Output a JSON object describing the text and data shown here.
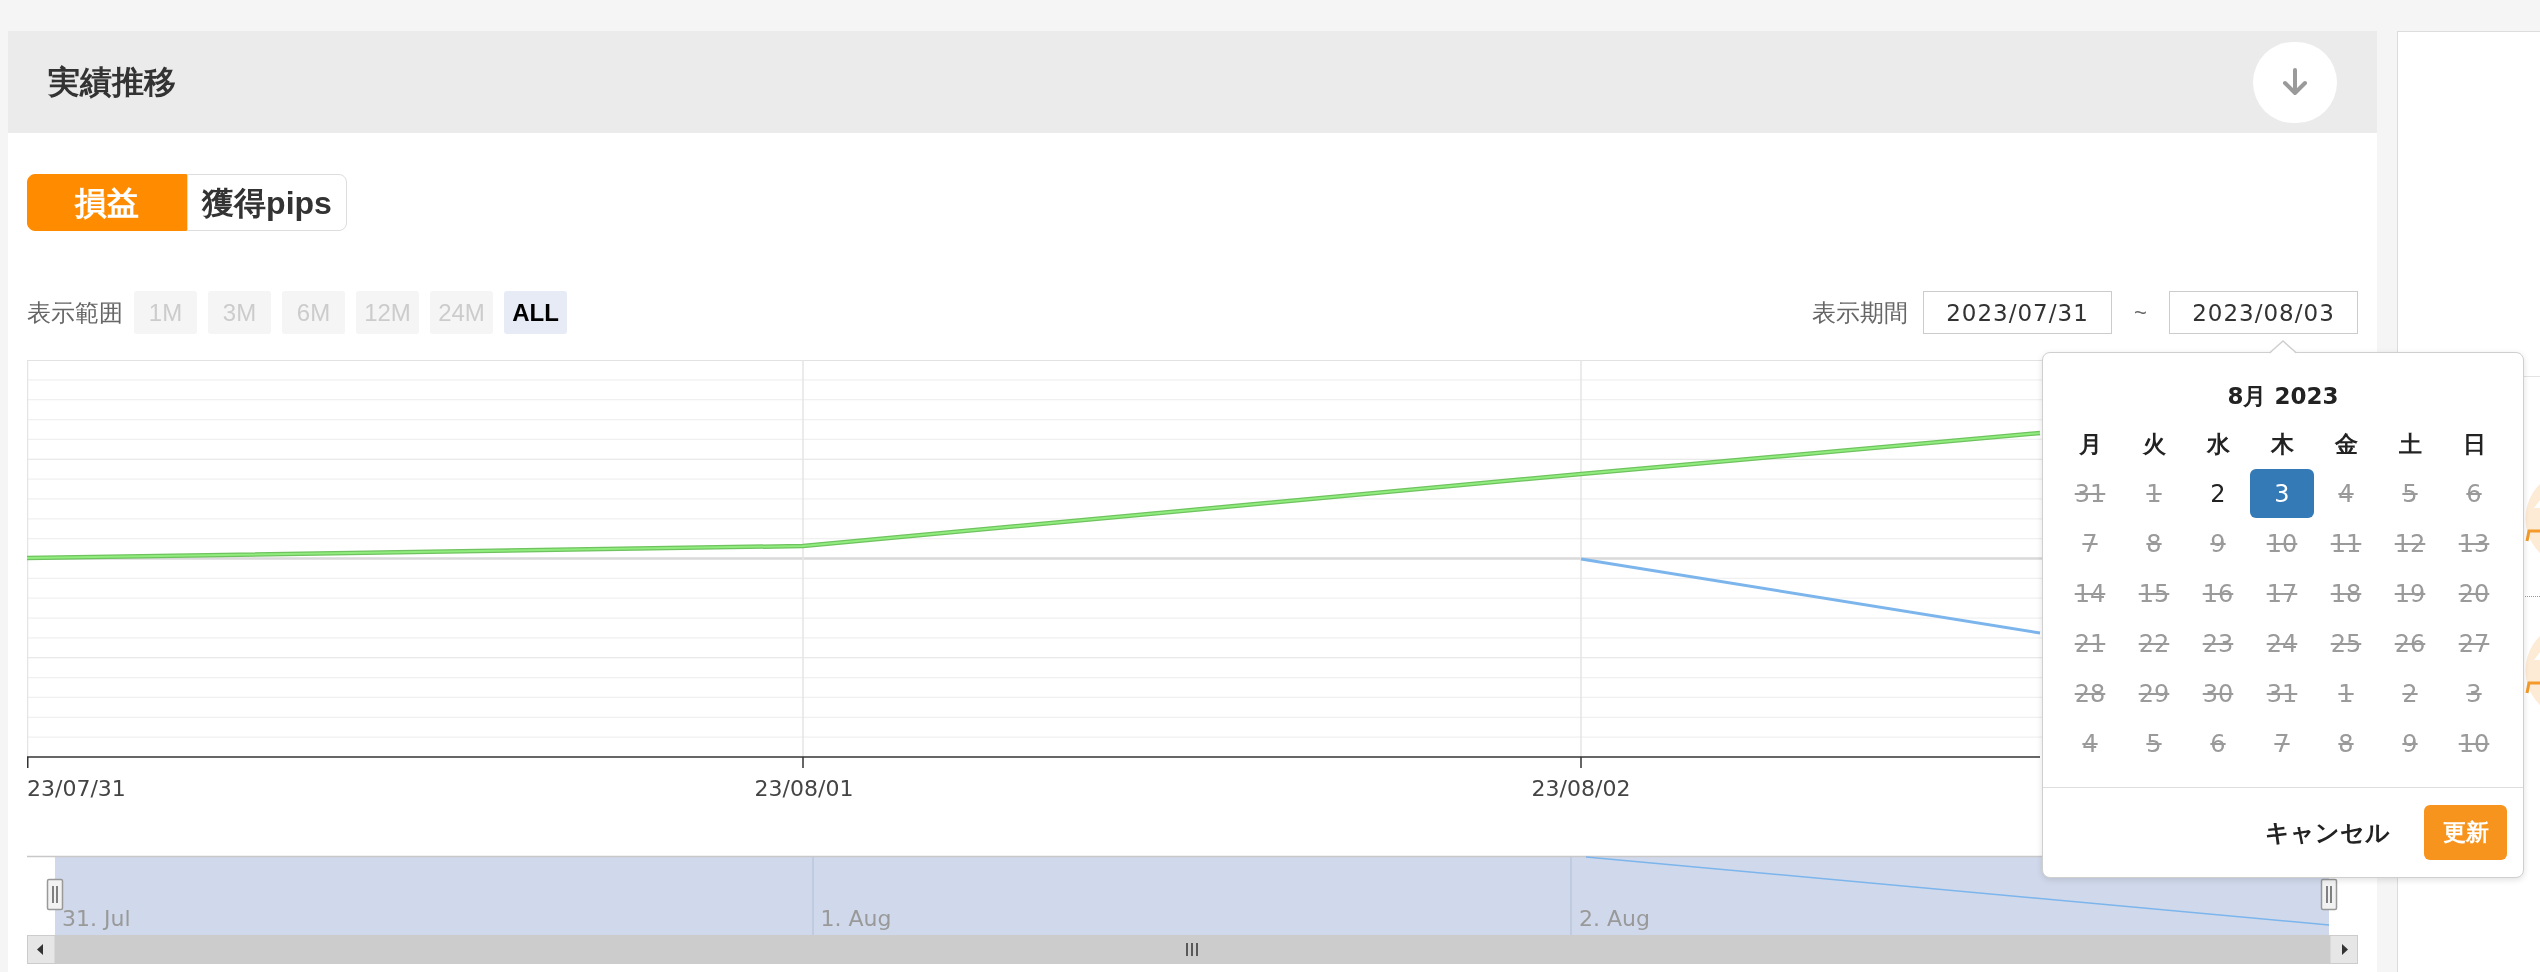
{
  "panel": {
    "title": "実績推移"
  },
  "tabs": [
    {
      "label": "損益",
      "selected": true
    },
    {
      "label": "獲得pips",
      "selected": false
    }
  ],
  "range": {
    "label": "表示範囲",
    "options": [
      {
        "label": "1M",
        "selected": false,
        "disabled": true
      },
      {
        "label": "3M",
        "selected": false,
        "disabled": true
      },
      {
        "label": "6M",
        "selected": false,
        "disabled": true
      },
      {
        "label": "12M",
        "selected": false,
        "disabled": true
      },
      {
        "label": "24M",
        "selected": false,
        "disabled": true
      },
      {
        "label": "ALL",
        "selected": true,
        "disabled": false
      }
    ]
  },
  "period": {
    "label": "表示期間",
    "start": "2023/07/31",
    "separator": "~",
    "end": "2023/08/03"
  },
  "chart": {
    "x_axis_labels": [
      "23/07/31",
      "23/08/01",
      "23/08/02"
    ]
  },
  "navigator": {
    "labels": [
      "31. Jul",
      "1. Aug",
      "2. Aug"
    ]
  },
  "date_picker": {
    "title": "8月 2023",
    "weekdays": [
      "月",
      "火",
      "水",
      "木",
      "金",
      "土",
      "日"
    ],
    "weeks": [
      [
        {
          "day": "31",
          "selected": false,
          "disabled": true
        },
        {
          "day": "1",
          "selected": false,
          "disabled": true
        },
        {
          "day": "2",
          "selected": false,
          "disabled": false
        },
        {
          "day": "3",
          "selected": true,
          "disabled": false
        },
        {
          "day": "4",
          "selected": false,
          "disabled": true
        },
        {
          "day": "5",
          "selected": false,
          "disabled": true
        },
        {
          "day": "6",
          "selected": false,
          "disabled": true
        }
      ],
      [
        {
          "day": "7",
          "selected": false,
          "disabled": true
        },
        {
          "day": "8",
          "selected": false,
          "disabled": true
        },
        {
          "day": "9",
          "selected": false,
          "disabled": true
        },
        {
          "day": "10",
          "selected": false,
          "disabled": true
        },
        {
          "day": "11",
          "selected": false,
          "disabled": true
        },
        {
          "day": "12",
          "selected": false,
          "disabled": true
        },
        {
          "day": "13",
          "selected": false,
          "disabled": true
        }
      ],
      [
        {
          "day": "14",
          "selected": false,
          "disabled": true
        },
        {
          "day": "15",
          "selected": false,
          "disabled": true
        },
        {
          "day": "16",
          "selected": false,
          "disabled": true
        },
        {
          "day": "17",
          "selected": false,
          "disabled": true
        },
        {
          "day": "18",
          "selected": false,
          "disabled": true
        },
        {
          "day": "19",
          "selected": false,
          "disabled": true
        },
        {
          "day": "20",
          "selected": false,
          "disabled": true
        }
      ],
      [
        {
          "day": "21",
          "selected": false,
          "disabled": true
        },
        {
          "day": "22",
          "selected": false,
          "disabled": true
        },
        {
          "day": "23",
          "selected": false,
          "disabled": true
        },
        {
          "day": "24",
          "selected": false,
          "disabled": true
        },
        {
          "day": "25",
          "selected": false,
          "disabled": true
        },
        {
          "day": "26",
          "selected": false,
          "disabled": true
        },
        {
          "day": "27",
          "selected": false,
          "disabled": true
        }
      ],
      [
        {
          "day": "28",
          "selected": false,
          "disabled": true
        },
        {
          "day": "29",
          "selected": false,
          "disabled": true
        },
        {
          "day": "30",
          "selected": false,
          "disabled": true
        },
        {
          "day": "31",
          "selected": false,
          "disabled": true
        },
        {
          "day": "1",
          "selected": false,
          "disabled": true
        },
        {
          "day": "2",
          "selected": false,
          "disabled": true
        },
        {
          "day": "3",
          "selected": false,
          "disabled": true
        }
      ],
      [
        {
          "day": "4",
          "selected": false,
          "disabled": true
        },
        {
          "day": "5",
          "selected": false,
          "disabled": true
        },
        {
          "day": "6",
          "selected": false,
          "disabled": true
        },
        {
          "day": "7",
          "selected": false,
          "disabled": true
        },
        {
          "day": "8",
          "selected": false,
          "disabled": true
        },
        {
          "day": "9",
          "selected": false,
          "disabled": true
        },
        {
          "day": "10",
          "selected": false,
          "disabled": true
        }
      ]
    ],
    "cancel": "キャンセル",
    "confirm": "更新"
  }
}
